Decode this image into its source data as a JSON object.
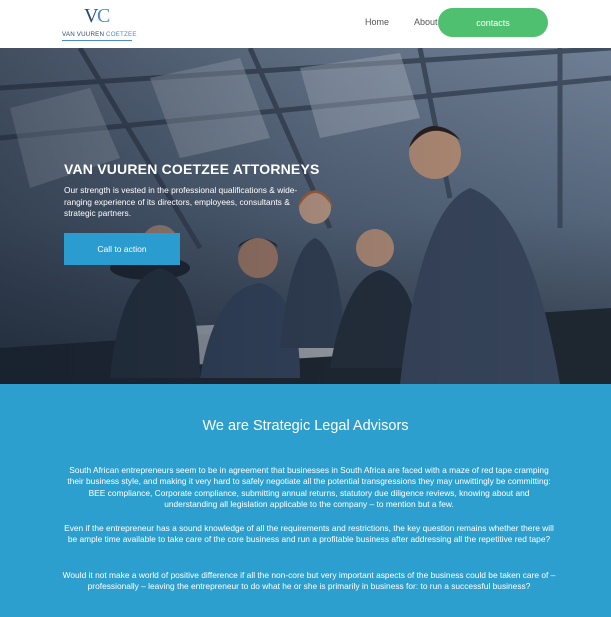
{
  "header": {
    "logo_letters": "VC",
    "logo_name_dark": "VAN VUUREN ",
    "logo_name_light": "COETZEE",
    "nav": [
      {
        "label": "Home"
      },
      {
        "label": "About Us"
      }
    ],
    "contacts_label": "contacts"
  },
  "hero": {
    "title": "VAN VUUREN COETZEE ATTORNEYS",
    "text": "Our strength is vested in the professional qualifications & wide-ranging experience of its directors, employees, consultants & strategic partners.",
    "cta_label": "Call to action"
  },
  "about": {
    "title": "We are Strategic Legal Advisors",
    "paragraphs": [
      "South African entrepreneurs seem to be in agreement that businesses in South Africa are faced with a maze of red tape cramping their business style, and making it very hard to safely negotiate all the potential transgressions they may unwittingly be committing: BEE compliance, Corporate compliance, submitting annual returns, statutory due diligence reviews, knowing about and understanding all legislation applicable to the company – to mention but a few.",
      "Even if the entrepreneur has a sound knowledge of all the requirements and restrictions, the key question remains whether there will be ample time available to take care of the core business and run a profitable business after addressing all the repetitive red tape?",
      "Would it not make a world of positive difference if all the non-core but very important aspects of the business could be taken care of – professionally – leaving the entrepreneur to do what he or she is primarily in business for: to run a successful business?"
    ]
  },
  "colors": {
    "accent_blue": "#2d9fcf",
    "button_green": "#4fc06f",
    "logo_navy": "#2b4a7a"
  }
}
